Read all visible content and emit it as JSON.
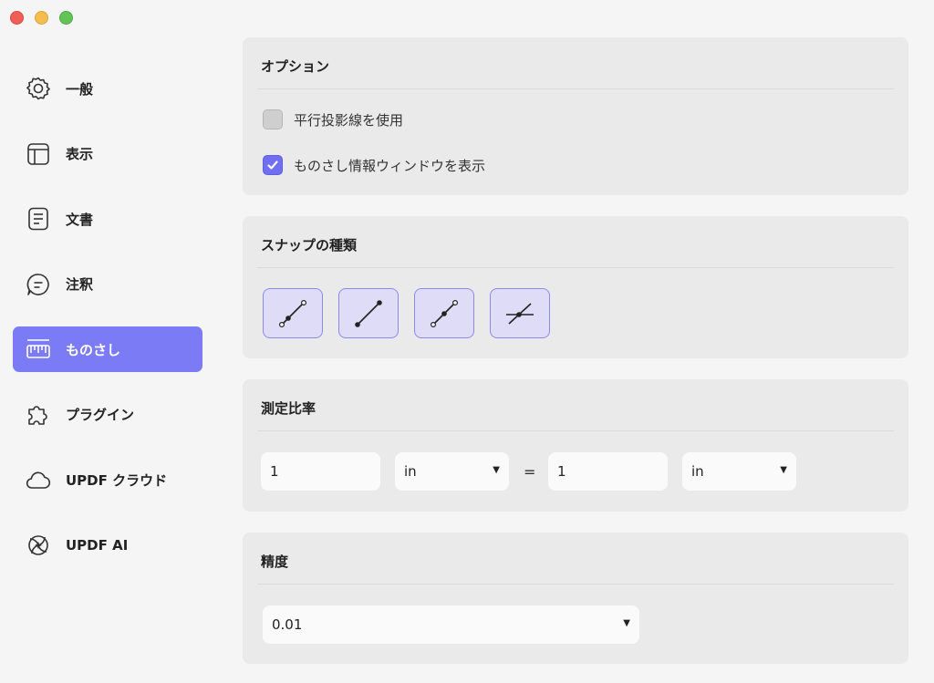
{
  "sidebar": {
    "items": [
      {
        "label": "一般",
        "icon": "gear-icon"
      },
      {
        "label": "表示",
        "icon": "layout-icon"
      },
      {
        "label": "文書",
        "icon": "document-icon"
      },
      {
        "label": "注釈",
        "icon": "comment-icon"
      },
      {
        "label": "ものさし",
        "icon": "ruler-icon",
        "active": true
      },
      {
        "label": "プラグイン",
        "icon": "puzzle-icon"
      },
      {
        "label": "UPDF クラウド",
        "icon": "cloud-icon"
      },
      {
        "label": "UPDF AI",
        "icon": "ai-icon"
      }
    ]
  },
  "options": {
    "title": "オプション",
    "parallel": {
      "label": "平行投影線を使用",
      "checked": false
    },
    "ruler_info": {
      "label": "ものさし情報ウィンドウを表示",
      "checked": true
    }
  },
  "snap": {
    "title": "スナップの種類",
    "types": [
      "snap-to-path-icon",
      "snap-to-endpoint-icon",
      "snap-to-midpoint-icon",
      "snap-to-intersection-icon"
    ]
  },
  "scale": {
    "title": "測定比率",
    "left_value": "1",
    "left_unit": "in",
    "equals": "=",
    "right_value": "1",
    "right_unit": "in"
  },
  "precision": {
    "title": "精度",
    "value": "0.01"
  },
  "colors": {
    "accent": "#7b7bf6",
    "panel": "#ebeaeb",
    "background": "#f6f5f6"
  }
}
